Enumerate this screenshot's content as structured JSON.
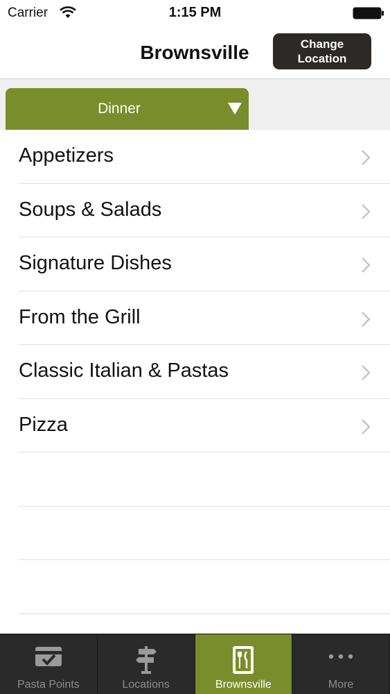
{
  "status_bar": {
    "carrier": "Carrier",
    "time": "1:15 PM"
  },
  "nav": {
    "title": "Brownsville",
    "change_line1": "Change",
    "change_line2": "Location"
  },
  "meal_selector": {
    "selected": "Dinner"
  },
  "menu": {
    "items": [
      {
        "label": "Appetizers"
      },
      {
        "label": "Soups & Salads"
      },
      {
        "label": "Signature Dishes"
      },
      {
        "label": "From the Grill"
      },
      {
        "label": "Classic Italian & Pastas"
      },
      {
        "label": "Pizza"
      }
    ]
  },
  "tabs": [
    {
      "label": "Pasta Points",
      "icon": "pasta-points-icon",
      "active": false
    },
    {
      "label": "Locations",
      "icon": "signpost-icon",
      "active": false
    },
    {
      "label": "Brownsville",
      "icon": "menu-fork-knife-icon",
      "active": true
    },
    {
      "label": "More",
      "icon": "more-dots-icon",
      "active": false
    }
  ],
  "colors": {
    "accent": "#7a8d2c",
    "button_dark": "#2d2926",
    "tab_bar": "#2a2a2a"
  }
}
